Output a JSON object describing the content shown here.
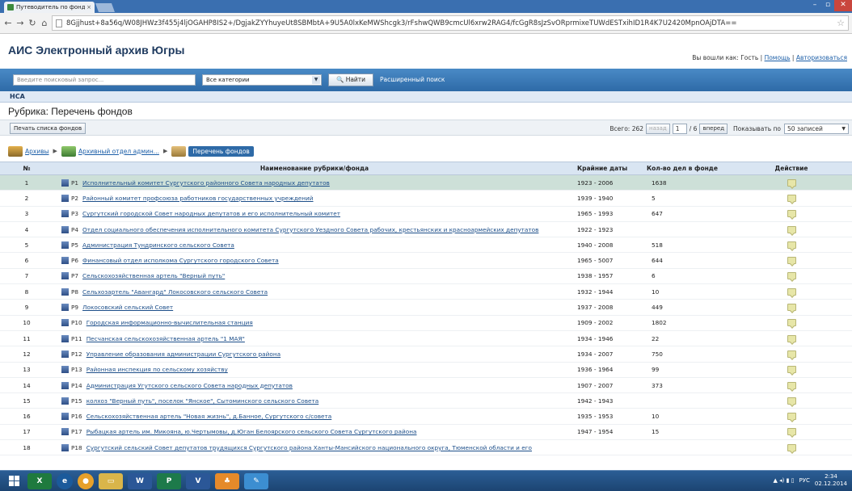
{
  "browser": {
    "tab_title": "Путеводитель по фондам",
    "tab_close": "×",
    "url": "8Gjjhust+8a56q/W08JHWz3f455j4ljOGAHP8IS2+/DgjakZYYhuyeUt8SBMbtA+9U5A0lxKeMWShcgk3/rFshwQWB9cmcUl6xrw2RAG4/fcGgR8sJzSvORprmixeTUWdESTxihID1R4K7U2420MpnOAjDTA=="
  },
  "site": {
    "title": "АИС Электронный архив Югры",
    "login_prefix": "Вы вошли как: Гость | ",
    "help": "Помощь",
    "sep": " | ",
    "auth": "Авторизоваться"
  },
  "search": {
    "placeholder": "Введите поисковый запрос...",
    "category": "Все категории",
    "button": "Найти",
    "advanced": "Расширенный поиск"
  },
  "nca": "НСА",
  "rubric_title": "Рубрика: Перечень фондов",
  "toolbar": {
    "print": "Печать списка фондов",
    "total": "Всего: 262",
    "prev": "назад",
    "page": "1",
    "of": "/ 6",
    "next": "вперед",
    "show_label": "Показывать по",
    "per_page": "50 записей"
  },
  "breadcrumbs": {
    "archives": "Архивы",
    "dept": "Архивный отдел админ...",
    "current": "Перечень фондов"
  },
  "table": {
    "headers": {
      "num": "№",
      "name": "Наименование рубрики/фонда",
      "dates": "Крайние даты",
      "count": "Кол-во дел в фонде",
      "action": "Действие"
    },
    "rows": [
      {
        "n": "1",
        "code": "Р1",
        "name": "Исполнительный комитет Сургутского районного Совета народных депутатов",
        "dates": "1923 - 2006",
        "count": "1638"
      },
      {
        "n": "2",
        "code": "Р2",
        "name": "Районный комитет профсоюза работников государственных учреждений",
        "dates": "1939 - 1940",
        "count": "5"
      },
      {
        "n": "3",
        "code": "Р3",
        "name": "Сургутский городской Совет народных депутатов и его исполнительный комитет",
        "dates": "1965 - 1993",
        "count": "647"
      },
      {
        "n": "4",
        "code": "Р4",
        "name": "Отдел социального обеспечения исполнительного комитета Сургутского Уездного Совета рабочих, крестьянских и красноармейских депутатов",
        "dates": "1922 - 1923",
        "count": ""
      },
      {
        "n": "5",
        "code": "Р5",
        "name": "Администрация Тундринского сельского Совета",
        "dates": "1940 - 2008",
        "count": "518"
      },
      {
        "n": "6",
        "code": "Р6",
        "name": "Финансовый отдел исполкома Сургутского городского Совета",
        "dates": "1965 - 5007",
        "count": "644"
      },
      {
        "n": "7",
        "code": "Р7",
        "name": "Сельскохозяйственная артель \"Верный путь\"",
        "dates": "1938 - 1957",
        "count": "6"
      },
      {
        "n": "8",
        "code": "Р8",
        "name": "Сельхозартель \"Авангард\" Локосовского сельского Совета",
        "dates": "1932 - 1944",
        "count": "10"
      },
      {
        "n": "9",
        "code": "Р9",
        "name": "Локосовский сельский Совет",
        "dates": "1937 - 2008",
        "count": "449"
      },
      {
        "n": "10",
        "code": "Р10",
        "name": "Городская информационно-вычислительная станция",
        "dates": "1909 - 2002",
        "count": "1802"
      },
      {
        "n": "11",
        "code": "Р11",
        "name": "Песчанская сельскохозяйственная артель \"1 МАЯ\"",
        "dates": "1934 - 1946",
        "count": "22"
      },
      {
        "n": "12",
        "code": "Р12",
        "name": "Управление образования администрации Сургутского района",
        "dates": "1934 - 2007",
        "count": "750"
      },
      {
        "n": "13",
        "code": "Р13",
        "name": "Районная инспекция по сельскому хозяйству",
        "dates": "1936 - 1964",
        "count": "99"
      },
      {
        "n": "14",
        "code": "Р14",
        "name": "Администрация Угутского сельского Совета народных депутатов",
        "dates": "1907 - 2007",
        "count": "373"
      },
      {
        "n": "15",
        "code": "Р15",
        "name": "колхоз \"Верный путь\", поселок \"Янское\", Сытоминского сельского Совета",
        "dates": "1942 - 1943",
        "count": ""
      },
      {
        "n": "16",
        "code": "Р16",
        "name": "Сельскохозяйственная артель \"Новая жизнь\", д.Банное, Сургутского с/совета",
        "dates": "1935 - 1953",
        "count": "10"
      },
      {
        "n": "17",
        "code": "Р17",
        "name": "Рыбацкая артель им. Микояна, ю.Чертымовы, д.Юган Белоярского сельского Совета Сургутского района",
        "dates": "1947 - 1954",
        "count": "15"
      },
      {
        "n": "18",
        "code": "Р18",
        "name": "Сургутский сельский Совет депутатов трудящихся Сургутского района Ханты-Мансийского национального округа, Тюменской области и его",
        "dates": "",
        "count": ""
      }
    ]
  },
  "taskbar": {
    "lang": "РУС",
    "time": "2:34",
    "date": "02.12.2014"
  }
}
